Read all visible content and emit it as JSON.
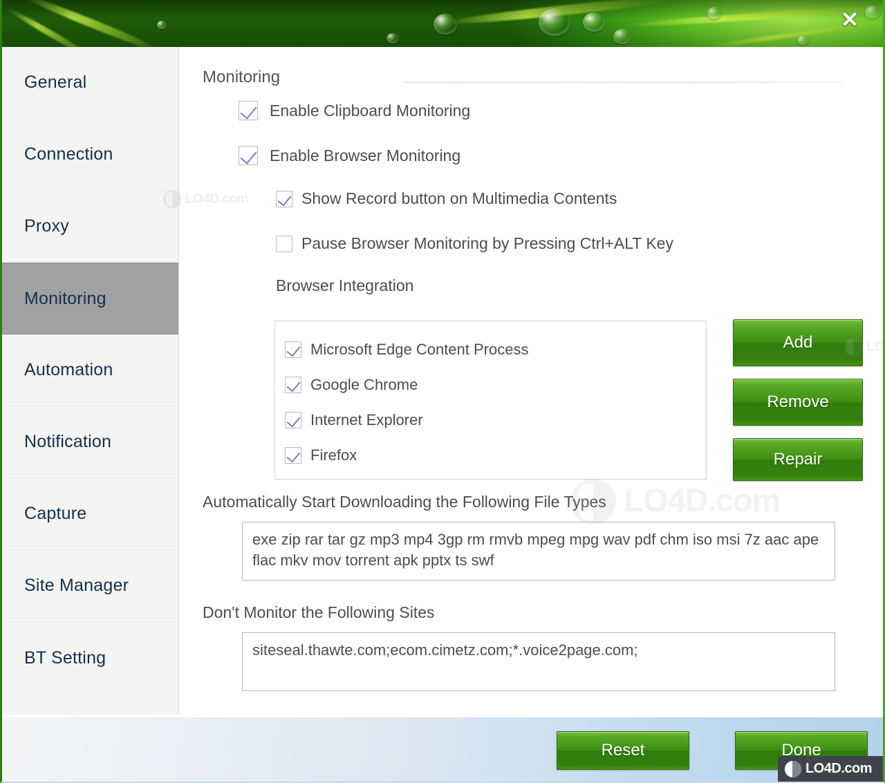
{
  "window": {
    "close_label": "✕"
  },
  "sidebar": {
    "items": [
      {
        "label": "General",
        "selected": false
      },
      {
        "label": "Connection",
        "selected": false
      },
      {
        "label": "Proxy",
        "selected": false
      },
      {
        "label": "Monitoring",
        "selected": true
      },
      {
        "label": "Automation",
        "selected": false
      },
      {
        "label": "Notification",
        "selected": false
      },
      {
        "label": "Capture",
        "selected": false
      },
      {
        "label": "Site Manager",
        "selected": false
      },
      {
        "label": "BT Setting",
        "selected": false
      }
    ]
  },
  "main": {
    "section_title": "Monitoring",
    "checkboxes": [
      {
        "label": "Enable Clipboard Monitoring",
        "checked": true
      },
      {
        "label": "Enable Browser Monitoring",
        "checked": true
      },
      {
        "label": "Show Record button on Multimedia Contents",
        "checked": true
      },
      {
        "label": "Pause Browser Monitoring by Pressing Ctrl+ALT Key",
        "checked": false
      }
    ],
    "browser_integration": {
      "label": "Browser Integration",
      "items": [
        {
          "label": "Microsoft Edge Content Process",
          "checked": true
        },
        {
          "label": "Google Chrome",
          "checked": true
        },
        {
          "label": "Internet Explorer",
          "checked": true
        },
        {
          "label": "Firefox",
          "checked": true
        }
      ],
      "buttons": {
        "add": "Add",
        "remove": "Remove",
        "repair": "Repair"
      }
    },
    "file_types": {
      "label": "Automatically Start Downloading the Following File Types",
      "value": "exe zip rar tar gz mp3 mp4 3gp rm rmvb mpeg mpg wav pdf chm iso msi 7z aac ape flac mkv mov torrent apk pptx ts swf"
    },
    "excluded_sites": {
      "label": "Don't Monitor the Following Sites",
      "value": "siteseal.thawte.com;ecom.cimetz.com;*.voice2page.com;"
    }
  },
  "footer": {
    "reset_label": "Reset",
    "done_label": "Done"
  },
  "watermark": {
    "text": "LO4D.com"
  },
  "colors": {
    "accent_green": "#3f8f12",
    "button_border": "#2d6b0d",
    "sidebar_text": "#12304f",
    "selected_item": "#a1a1a1",
    "checkmark": "#7b7bc4",
    "body_text": "#4d4d4d",
    "footer_gradient_end": "#b3d2ec"
  }
}
